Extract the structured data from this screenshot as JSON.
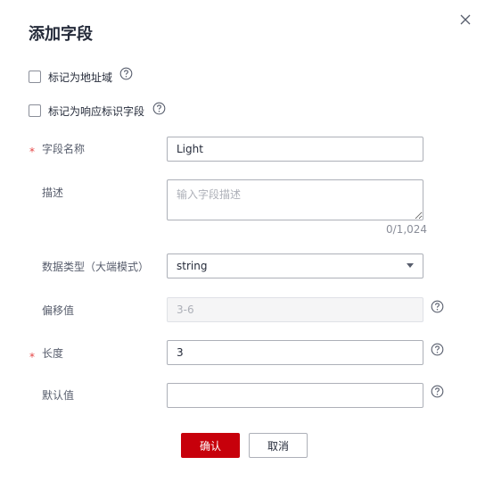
{
  "dialog": {
    "title": "添加字段",
    "close_icon": "close-icon"
  },
  "checkboxes": {
    "address_domain": {
      "label": "标记为地址域",
      "checked": false
    },
    "response_flag": {
      "label": "标记为响应标识字段",
      "checked": false
    }
  },
  "form": {
    "field_name": {
      "label": "字段名称",
      "required_mark": "*",
      "value": "Light"
    },
    "description": {
      "label": "描述",
      "placeholder": "输入字段描述",
      "value": "",
      "counter": "0/1,024"
    },
    "data_type": {
      "label": "数据类型（大端模式）",
      "value": "string"
    },
    "offset": {
      "label": "偏移值",
      "value": "3-6"
    },
    "length": {
      "label": "长度",
      "required_mark": "*",
      "value": "3"
    },
    "default_value": {
      "label": "默认值",
      "value": ""
    }
  },
  "buttons": {
    "confirm": "确认",
    "cancel": "取消"
  },
  "colors": {
    "primary": "#c7000b",
    "required": "#e54545",
    "border": "#adb0b8"
  }
}
